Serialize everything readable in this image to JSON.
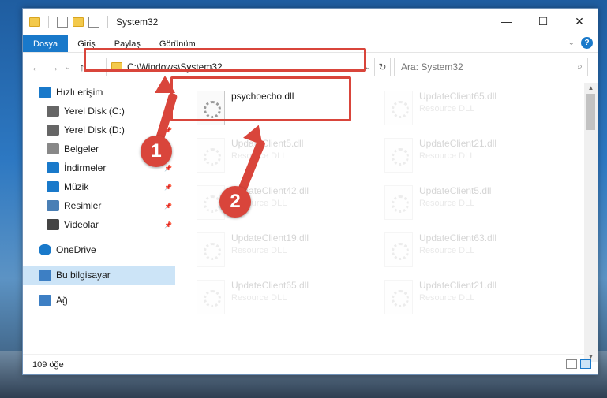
{
  "window": {
    "title": "System32",
    "ctrl_min": "—",
    "ctrl_max": "☐",
    "ctrl_close": "✕"
  },
  "ribbon": {
    "tabs": [
      "Dosya",
      "Giriş",
      "Paylaş",
      "Görünüm"
    ],
    "help": "?"
  },
  "nav": {
    "back": "←",
    "forward": "→",
    "recent": "⌄",
    "up": "↑"
  },
  "address": {
    "path": "C:\\Windows\\System32",
    "dropdown": "⌄",
    "refresh": "↻"
  },
  "search": {
    "placeholder": "Ara: System32",
    "icon": "⌕"
  },
  "sidebar": {
    "items": [
      {
        "label": "Hızlı erişim",
        "icon": "star-icon",
        "pinned": false
      },
      {
        "label": "Yerel Disk (C:)",
        "icon": "drive-icon",
        "pinned": true
      },
      {
        "label": "Yerel Disk (D:)",
        "icon": "drive-icon",
        "pinned": true
      },
      {
        "label": "Belgeler",
        "icon": "documents-icon",
        "pinned": true
      },
      {
        "label": "İndirmeler",
        "icon": "download-icon",
        "pinned": true
      },
      {
        "label": "Müzik",
        "icon": "music-icon",
        "pinned": true
      },
      {
        "label": "Resimler",
        "icon": "pictures-icon",
        "pinned": true
      },
      {
        "label": "Videolar",
        "icon": "video-icon",
        "pinned": true
      },
      {
        "label": "OneDrive",
        "icon": "cloud-icon",
        "pinned": false
      },
      {
        "label": "Bu bilgisayar",
        "icon": "computer-icon",
        "pinned": false
      },
      {
        "label": "Ağ",
        "icon": "network-icon",
        "pinned": false
      }
    ],
    "pin_glyph": "📌"
  },
  "files": [
    {
      "name": "psychoecho.dll",
      "sub": ""
    },
    {
      "name": "UpdateClient65.dll",
      "sub": "Resource DLL"
    },
    {
      "name": "UpdateClient5.dll",
      "sub": "Resource DLL"
    },
    {
      "name": "UpdateClient21.dll",
      "sub": "Resource DLL"
    },
    {
      "name": "UpdateClient42.dll",
      "sub": "Resource DLL"
    },
    {
      "name": "UpdateClient5.dll",
      "sub": "Resource DLL"
    },
    {
      "name": "UpdateClient19.dll",
      "sub": "Resource DLL"
    },
    {
      "name": "UpdateClient63.dll",
      "sub": "Resource DLL"
    },
    {
      "name": "UpdateClient65.dll",
      "sub": "Resource DLL"
    },
    {
      "name": "UpdateClient21.dll",
      "sub": "Resource DLL"
    }
  ],
  "status": {
    "count": "109 öğe"
  },
  "annotations": {
    "step1": "1",
    "step2": "2",
    "color": "#d9453b"
  }
}
